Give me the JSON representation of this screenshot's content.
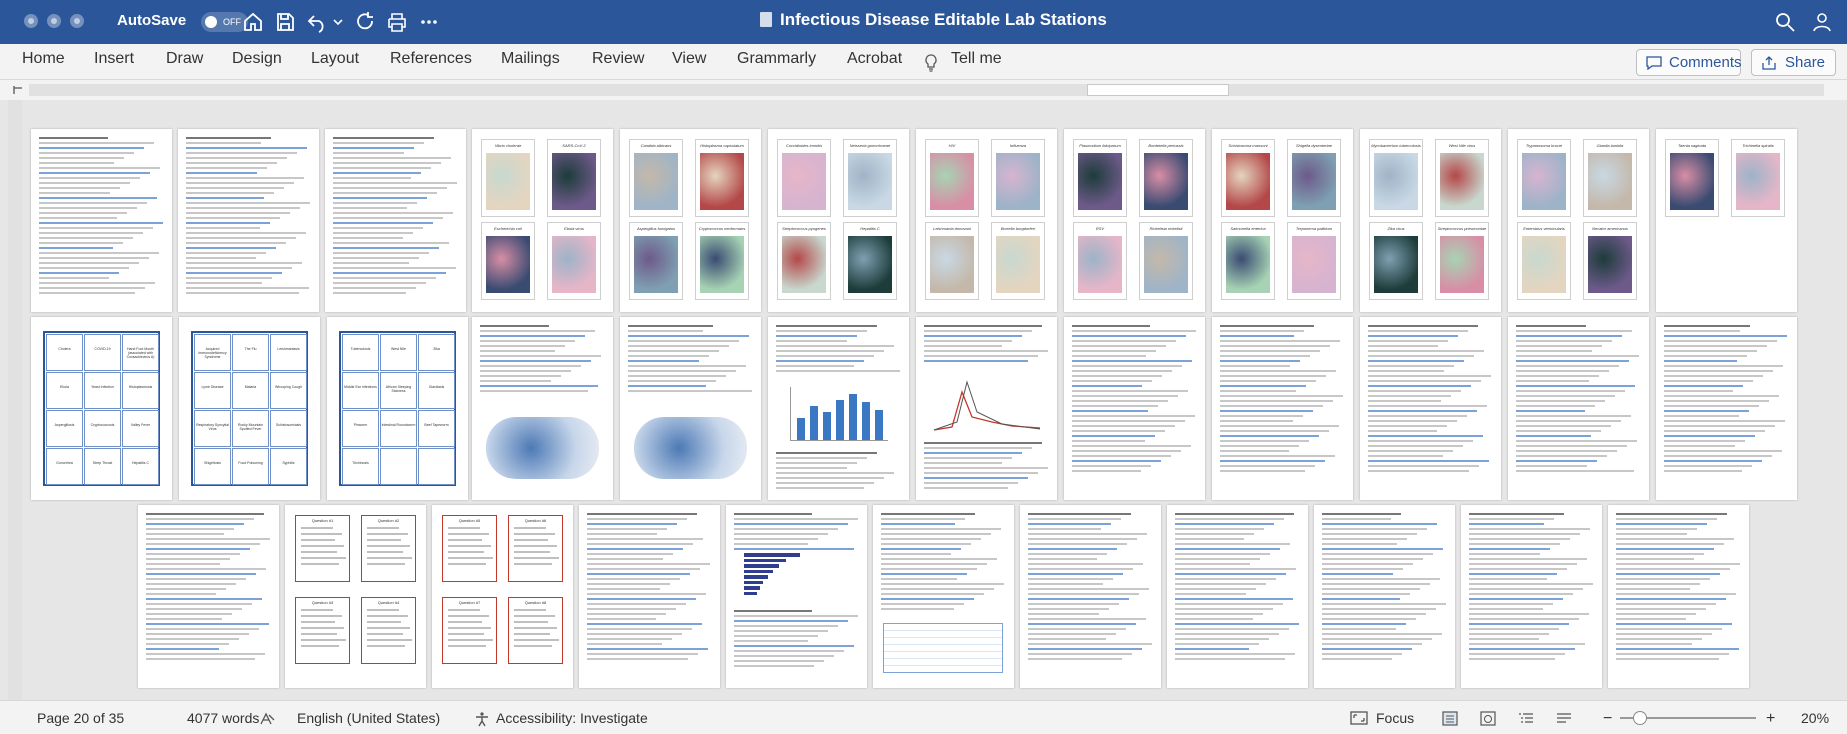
{
  "titlebar": {
    "autosave_label": "AutoSave",
    "autosave_state": "OFF",
    "document_title": "Infectious Disease Editable Lab Stations"
  },
  "ribbon": {
    "tabs": [
      "Home",
      "Insert",
      "Draw",
      "Design",
      "Layout",
      "References",
      "Mailings",
      "Review",
      "View",
      "Grammarly",
      "Acrobat"
    ],
    "tell_me": "Tell me",
    "comments_label": "Comments",
    "share_label": "Share"
  },
  "specimen_cards": [
    [
      "Vibrio cholerae",
      "SARS-CoV-2",
      "Escherichia coli",
      "Ebola virus"
    ],
    [
      "Candida albicans",
      "Histoplasma capsulatum",
      "Aspergillus fumigatus",
      "Cryptococcus neoformans"
    ],
    [
      "Coccidioides immitis",
      "Neisseria gonorrhoeae",
      "Streptococcus pyogenes",
      "Hepatitis C"
    ],
    [
      "HIV",
      "Influenza",
      "Leishmania donovani",
      "Borrelia burgdorferi"
    ],
    [
      "Plasmodium falciparum",
      "Bordetella pertussis",
      "RSV",
      "Rickettsia rickettsii"
    ],
    [
      "Schistosoma mansoni",
      "Shigella dysenteriae",
      "Salmonella enterica",
      "Treponema pallidum"
    ],
    [
      "Mycobacterium tuberculosis",
      "West Nile virus",
      "Zika virus",
      "Streptococcus pneumoniae"
    ],
    [
      "Trypanosoma brucei",
      "Giardia lamblia",
      "Enterobius vermicularis",
      "Necator americanus"
    ],
    [
      "Taenia saginata",
      "Trichinella spiralis"
    ]
  ],
  "disease_grids": [
    [
      "Cholera",
      "COVID-19",
      "Hand Foot Mouth (associated with Coxsackievirus A)",
      "Ebola",
      "Yeast Infection",
      "Histoplasmosis",
      "Aspergillosis",
      "Cryptococcosis",
      "Valley Fever",
      "Gonorrhea",
      "Strep Throat",
      "Hepatitis C"
    ],
    [
      "Acquired Immunodeficiency Syndrome",
      "The Flu",
      "Leishmaniasis",
      "Lyme Disease",
      "Malaria",
      "Whooping Cough",
      "Respiratory Syncytial Virus",
      "Rocky Mountain Spotted Fever",
      "Schistosomiasis",
      "Shigellosis",
      "Food Poisoning",
      "Syphilis"
    ],
    [
      "Tuberculosis",
      "West Nile",
      "Zika",
      "Middle Ear Infections",
      "African Sleeping Sickness",
      "Giardiasis",
      "Pinworm",
      "Intestinal Roundworm",
      "Beef Tapeworm",
      "Trichinosis"
    ]
  ],
  "question_cards": [
    "Question #1",
    "Question #2",
    "Question #3",
    "Question #4",
    "Question #5",
    "Question #6",
    "Question #7",
    "Question #8"
  ],
  "status": {
    "page": "Page 20 of 35",
    "words": "4077 words",
    "language": "English (United States)",
    "accessibility": "Accessibility: Investigate",
    "focus": "Focus",
    "zoom": "20%"
  }
}
